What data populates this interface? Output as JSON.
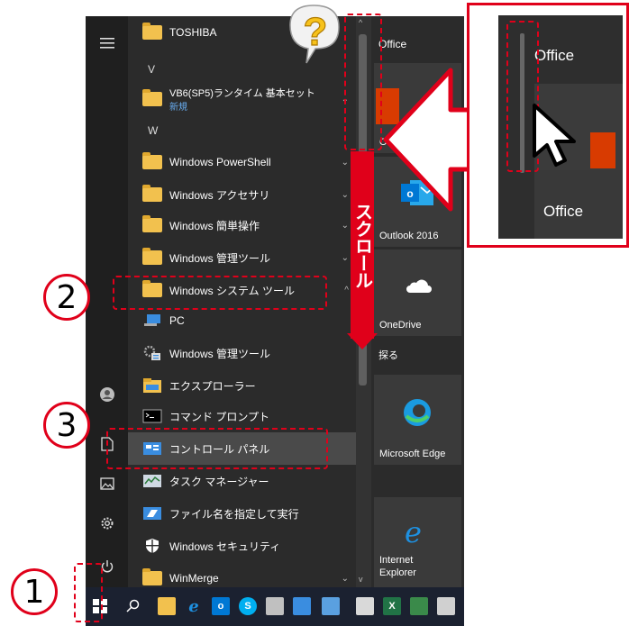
{
  "start_menu": {
    "rail": {
      "menu_icon": "hamburger-icon",
      "user_icon": "user-icon",
      "documents_icon": "document-icon",
      "pictures_icon": "pictures-icon",
      "settings_icon": "gear-icon",
      "power_icon": "power-icon"
    },
    "apps": [
      {
        "type": "folder",
        "label": "TOSHIBA",
        "chevron": "⌄"
      },
      {
        "type": "letter",
        "label": "V"
      },
      {
        "type": "folder",
        "label": "VB6(SP5)ランタイム 基本セット",
        "sublabel": "新規",
        "chevron": "⌄"
      },
      {
        "type": "letter",
        "label": "W"
      },
      {
        "type": "folder",
        "label": "Windows PowerShell",
        "chevron": "⌄"
      },
      {
        "type": "folder",
        "label": "Windows アクセサリ",
        "chevron": "⌄"
      },
      {
        "type": "folder",
        "label": "Windows 簡単操作",
        "chevron": "⌄"
      },
      {
        "type": "folder",
        "label": "Windows 管理ツール",
        "chevron": "⌄"
      },
      {
        "type": "folder",
        "label": "Windows システム ツール",
        "chevron": "^"
      },
      {
        "type": "app",
        "label": "PC",
        "icon": "pc-icon"
      },
      {
        "type": "app",
        "label": "Windows 管理ツール",
        "icon": "admin-tools-icon"
      },
      {
        "type": "app",
        "label": "エクスプローラー",
        "icon": "explorer-icon"
      },
      {
        "type": "app",
        "label": "コマンド プロンプト",
        "icon": "command-prompt-icon"
      },
      {
        "type": "app",
        "label": "コントロール パネル",
        "icon": "control-panel-icon"
      },
      {
        "type": "app",
        "label": "タスク マネージャー",
        "icon": "task-manager-icon"
      },
      {
        "type": "app",
        "label": "ファイル名を指定して実行",
        "icon": "run-icon"
      },
      {
        "type": "app",
        "label": "Windows セキュリティ",
        "icon": "shield-icon"
      },
      {
        "type": "folder",
        "label": "WinMerge",
        "chevron": "⌄"
      }
    ],
    "tiles": {
      "group_office": "Office",
      "office_tile": "Office",
      "outlook": "Outlook 2016",
      "onedrive": "OneDrive",
      "group_explore": "探る",
      "edge": "Microsoft Edge",
      "ie_line1": "Internet",
      "ie_line2": "Explorer"
    }
  },
  "annotations": {
    "step1": "1",
    "step2": "2",
    "step3": "3",
    "scroll_label": "スクロール",
    "question_mark": "?",
    "zoom_office_top": "Office",
    "zoom_office_bottom": "Office"
  },
  "colors": {
    "accent_red": "#e0001a",
    "menu_bg": "#2b2b2b",
    "taskbar_bg": "#1b2130"
  }
}
